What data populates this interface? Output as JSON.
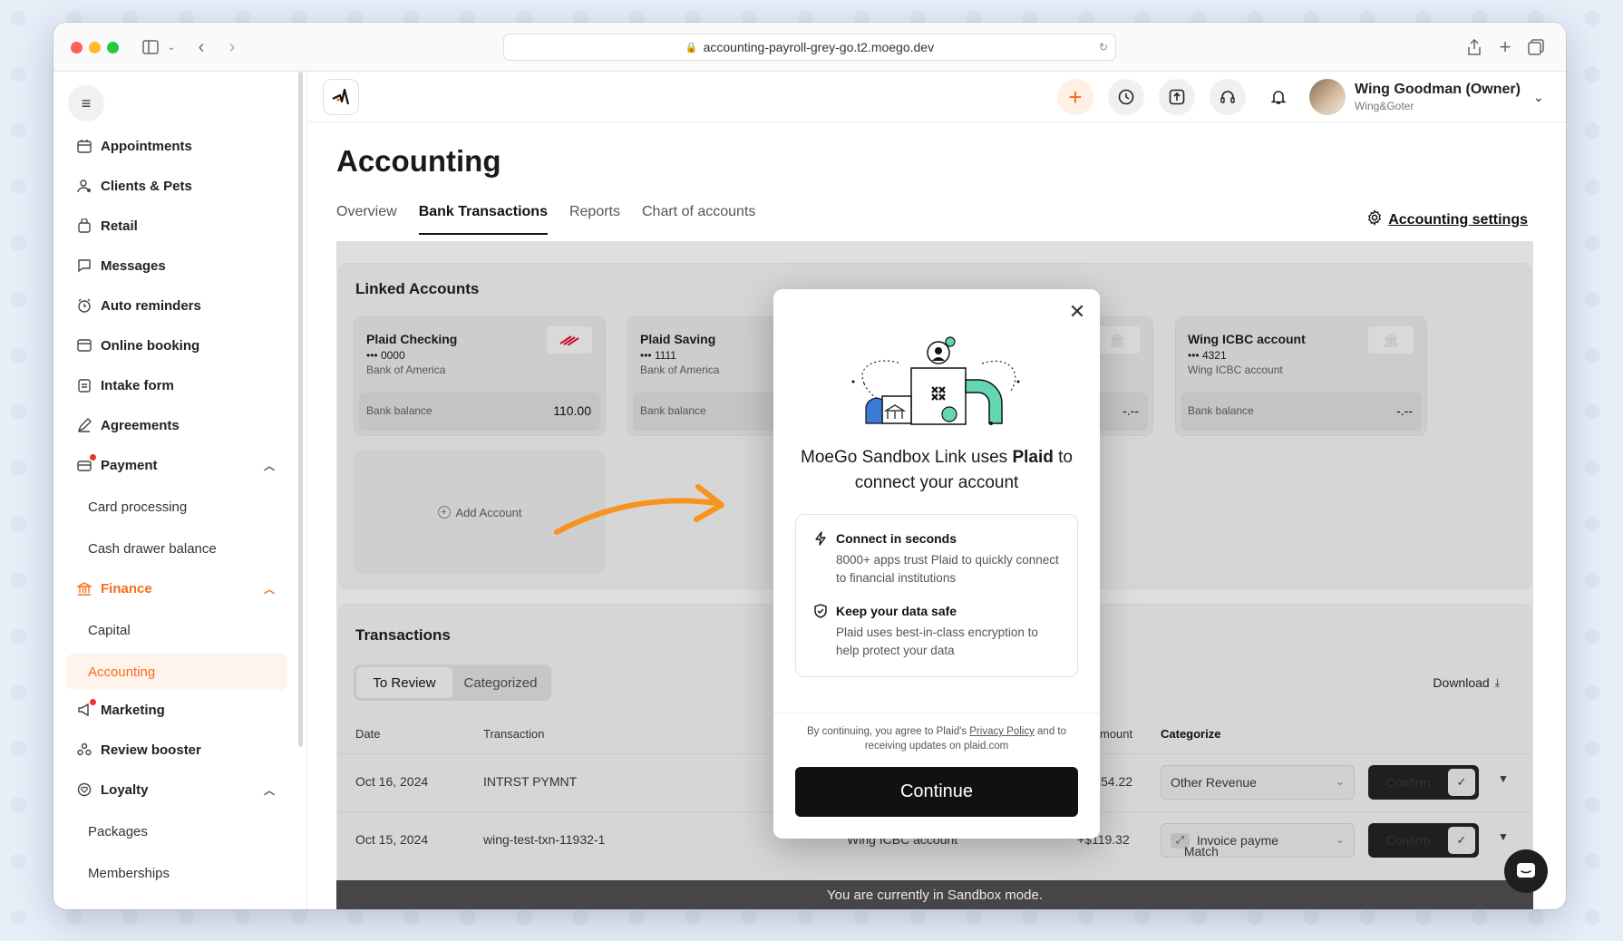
{
  "browser": {
    "url": "accounting-payroll-grey-go.t2.moego.dev"
  },
  "sidebar": {
    "items": [
      {
        "label": "Appointments"
      },
      {
        "label": "Clients & Pets"
      },
      {
        "label": "Retail"
      },
      {
        "label": "Messages"
      },
      {
        "label": "Auto reminders"
      },
      {
        "label": "Online booking"
      },
      {
        "label": "Intake form"
      },
      {
        "label": "Agreements"
      },
      {
        "label": "Payment"
      },
      {
        "label": "Card processing"
      },
      {
        "label": "Cash drawer balance"
      },
      {
        "label": "Finance"
      },
      {
        "label": "Capital"
      },
      {
        "label": "Accounting"
      },
      {
        "label": "Marketing"
      },
      {
        "label": "Review booster"
      },
      {
        "label": "Loyalty"
      },
      {
        "label": "Packages"
      },
      {
        "label": "Memberships"
      }
    ]
  },
  "user": {
    "name": "Wing Goodman (Owner)",
    "company": "Wing&Goter"
  },
  "page": {
    "title": "Accounting",
    "tabs": [
      "Overview",
      "Bank Transactions",
      "Reports",
      "Chart of accounts"
    ],
    "settings_label": "Accounting settings"
  },
  "linked": {
    "title": "Linked Accounts",
    "cards": [
      {
        "name": "Plaid Checking",
        "number": "••• 0000",
        "bank": "Bank of America",
        "balance_label": "Bank balance",
        "balance": "110.00"
      },
      {
        "name": "Plaid Saving",
        "number": "••• 1111",
        "bank": "Bank of America",
        "balance_label": "Bank balance",
        "balance": ""
      },
      {
        "name": "",
        "number": "",
        "bank": "",
        "balance_label": "",
        "balance": "-.--"
      },
      {
        "name": "Wing ICBC account",
        "number": "••• 4321",
        "bank": "Wing ICBC account",
        "balance_label": "Bank balance",
        "balance": "-.--"
      }
    ],
    "add_label": "Add Account"
  },
  "transactions": {
    "title": "Transactions",
    "seg": [
      "To Review",
      "Categorized"
    ],
    "download": "Download",
    "headers": {
      "date": "Date",
      "transaction": "Transaction",
      "amount": "mount",
      "categorize": "Categorize"
    },
    "rows": [
      {
        "date": "Oct 16, 2024",
        "txn": "INTRST PYMNT",
        "account": "",
        "amount": "54.22",
        "category": "Other Revenue",
        "confirm": "Confirm"
      },
      {
        "date": "Oct 15, 2024",
        "txn": "wing-test-txn-11932-1",
        "account": "Wing ICBC account",
        "amount": "+$119.32",
        "match": "Match",
        "category": "Invoice payme",
        "confirm": "Confirm"
      }
    ]
  },
  "banner": "You are currently in Sandbox mode.",
  "modal": {
    "heading_pre": "MoeGo Sandbox Link uses ",
    "heading_bold": "Plaid",
    "heading_post": " to connect your account",
    "f1_title": "Connect in seconds",
    "f1_desc": "8000+ apps trust Plaid to quickly connect to financial institutions",
    "f2_title": "Keep your data safe",
    "f2_desc": "Plaid uses best-in-class encryption to help protect your data",
    "foot_pre": "By continuing, you agree to Plaid's ",
    "foot_link": "Privacy Policy",
    "foot_post": " and to receiving updates on plaid.com",
    "continue": "Continue"
  },
  "colors": {
    "accent": "#f96b18",
    "dark": "#111111"
  }
}
